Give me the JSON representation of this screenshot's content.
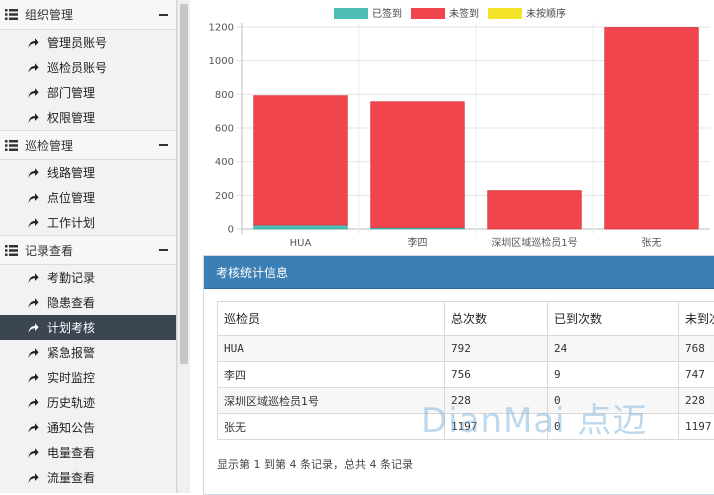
{
  "sidebar": {
    "groups": [
      {
        "title": "组织管理",
        "items": [
          {
            "label": "管理员账号",
            "active": false
          },
          {
            "label": "巡检员账号",
            "active": false
          },
          {
            "label": "部门管理",
            "active": false
          },
          {
            "label": "权限管理",
            "active": false
          }
        ]
      },
      {
        "title": "巡检管理",
        "items": [
          {
            "label": "线路管理",
            "active": false
          },
          {
            "label": "点位管理",
            "active": false
          },
          {
            "label": "工作计划",
            "active": false
          }
        ]
      },
      {
        "title": "记录查看",
        "items": [
          {
            "label": "考勤记录",
            "active": false
          },
          {
            "label": "隐患查看",
            "active": false
          },
          {
            "label": "计划考核",
            "active": true
          },
          {
            "label": "紧急报警",
            "active": false
          },
          {
            "label": "实时监控",
            "active": false
          },
          {
            "label": "历史轨迹",
            "active": false
          },
          {
            "label": "通知公告",
            "active": false
          },
          {
            "label": "电量查看",
            "active": false
          },
          {
            "label": "流量查看",
            "active": false
          }
        ]
      }
    ]
  },
  "colors": {
    "signed": "#4dbdb5",
    "unsigned": "#f0454c",
    "out_of_order": "#f5e52a",
    "panel_header": "#3c7fb5",
    "active_nav": "#3c4653"
  },
  "chart_data": {
    "type": "bar",
    "stacked": true,
    "categories": [
      "HUA",
      "李四",
      "深圳区域巡检员1号",
      "张无"
    ],
    "series": [
      {
        "name": "已签到",
        "values": [
          24,
          9,
          0,
          0
        ]
      },
      {
        "name": "未签到",
        "values": [
          768,
          747,
          228,
          1197
        ]
      },
      {
        "name": "未按顺序",
        "values": [
          0,
          0,
          0,
          0
        ]
      }
    ],
    "ylim": [
      0,
      1200
    ],
    "yticks": [
      0,
      200,
      400,
      600,
      800,
      1000,
      1200
    ],
    "grid": true,
    "legend": "top"
  },
  "panel": {
    "title": "考核统计信息",
    "columns": [
      "巡检员",
      "总次数",
      "已到次数",
      "未到次数"
    ],
    "rows": [
      [
        "HUA",
        "792",
        "24",
        "768"
      ],
      [
        "李四",
        "756",
        "9",
        "747"
      ],
      [
        "深圳区域巡检员1号",
        "228",
        "0",
        "228"
      ],
      [
        "张无",
        "1197",
        "0",
        "1197"
      ]
    ],
    "summary": "显示第 1 到第 4 条记录，总共 4 条记录"
  },
  "watermark": "DianMai 点迈"
}
